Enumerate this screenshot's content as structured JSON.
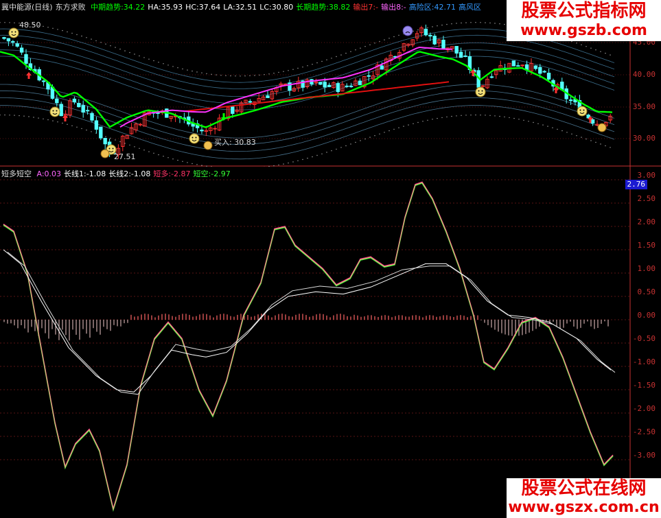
{
  "top": {
    "stock_name": "冀中能源(日线)",
    "indicator_name": "东方求败",
    "items": [
      {
        "label": "中期趋势",
        "value": ":34.22",
        "color": "#00ff00"
      },
      {
        "label": "HA",
        "value": ":35.93",
        "color": "#ffffff"
      },
      {
        "label": "HC",
        "value": ":37.64",
        "color": "#ffffff"
      },
      {
        "label": "LA",
        "value": ":32.51",
        "color": "#ffffff"
      },
      {
        "label": "LC",
        "value": ":30.80",
        "color": "#ffffff"
      },
      {
        "label": "长期趋势",
        "value": ":38.82",
        "color": "#00ff00"
      },
      {
        "label": "输出7",
        "value": ":-",
        "color": "#ff3333"
      },
      {
        "label": "输出8",
        "value": ":-",
        "color": "#ff66ff"
      },
      {
        "label": "高险区",
        "value": ":42.71",
        "color": "#3399ff"
      },
      {
        "label": "高风区",
        "value": "",
        "color": "#3399ff"
      }
    ],
    "y_ticks": [
      "45.00",
      "40.00",
      "35.00",
      "30.00"
    ],
    "high_label": "48.50",
    "low_label": "27.51",
    "buy_label": "买入: 30.83"
  },
  "bottom": {
    "indicator_name": "短多短空",
    "items": [
      {
        "label": "A",
        "value": ":0.03",
        "color": "#ff66ff"
      },
      {
        "label": "长线1",
        "value": ":-1.08",
        "color": "#ffffff"
      },
      {
        "label": "长线2",
        "value": ":-1.08",
        "color": "#ffffff"
      },
      {
        "label": "短多",
        "value": ":-2.87",
        "color": "#ff3366"
      },
      {
        "label": "短空",
        "value": ":-2.97",
        "color": "#33ff33"
      }
    ],
    "current_value": "2.76",
    "y_ticks": [
      "3.00",
      "2.50",
      "2.00",
      "1.50",
      "1.00",
      "0.50",
      "0.00",
      "-0.50",
      "-1.00",
      "-1.50",
      "-2.00",
      "-2.50",
      "-3.00"
    ]
  },
  "watermark_top": {
    "line1": "股票公式指标网",
    "line2": "www.gszb.com"
  },
  "watermark_bottom": {
    "line1": "股票公式在线网",
    "line2": "www.gszx.com.cn"
  },
  "colors": {
    "up": "#ff3232",
    "down": "#54ffff",
    "mid_trend": "#00ff00",
    "long_trend": "#ff1493",
    "axis": "#c83232"
  }
}
